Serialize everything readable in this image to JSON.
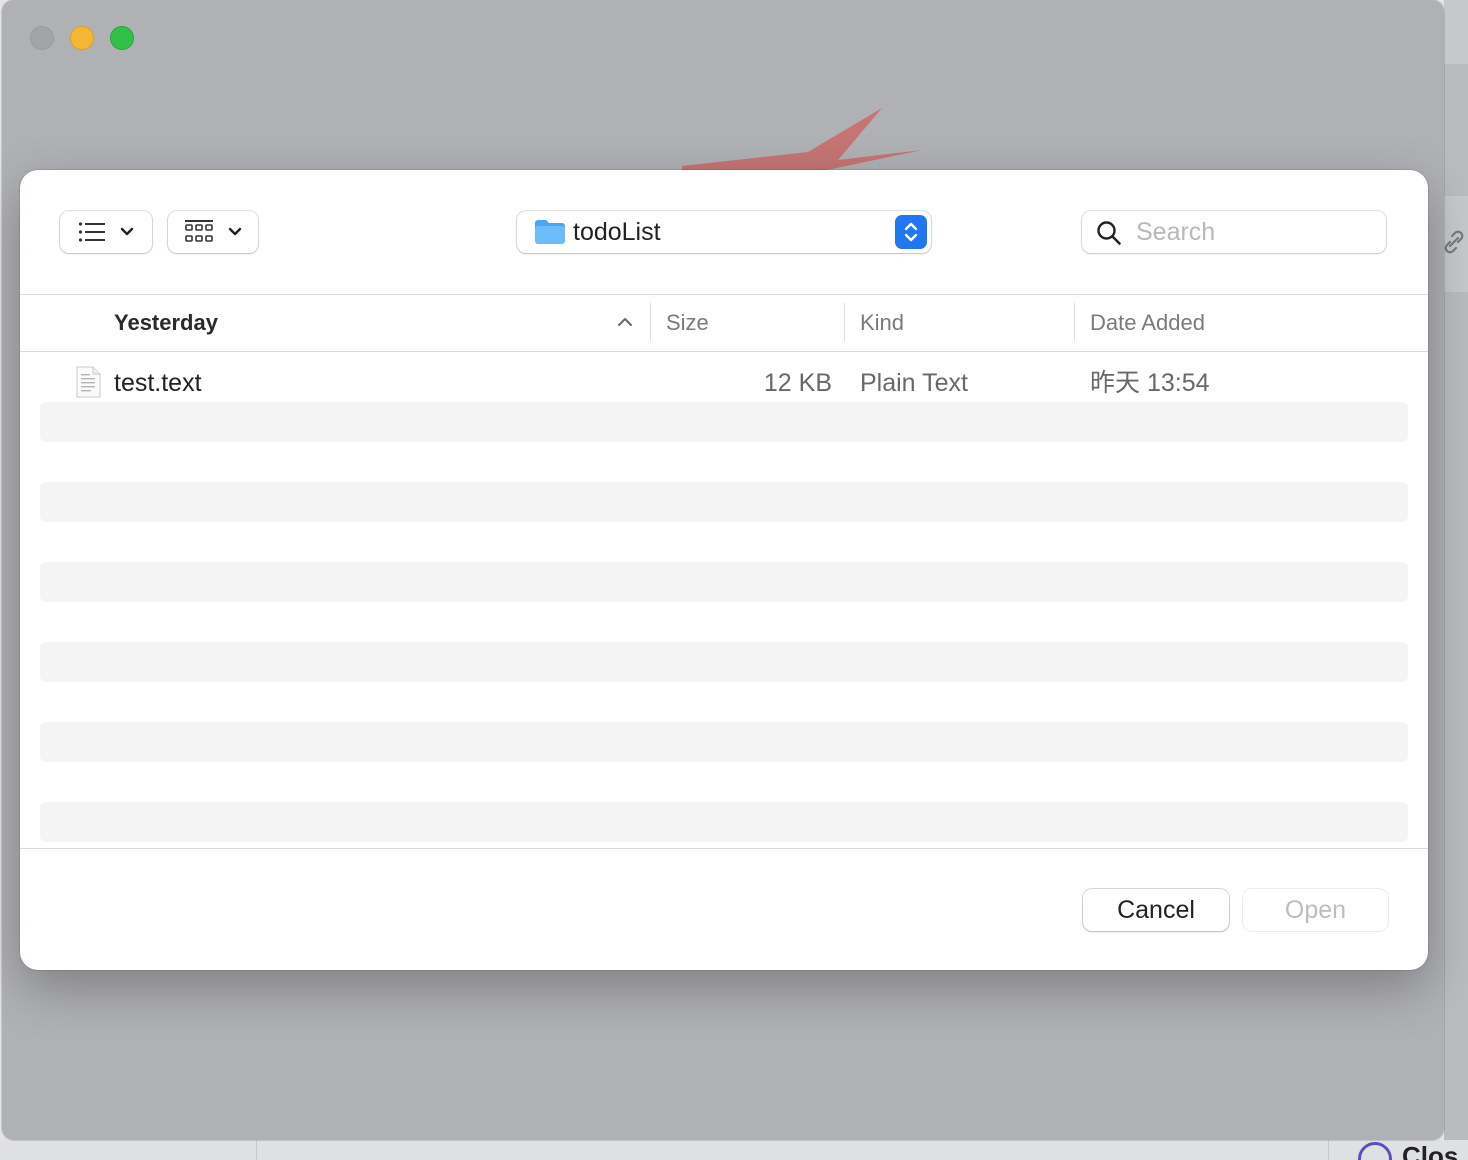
{
  "window": {
    "traffic_lights": [
      "close",
      "minimize",
      "maximize"
    ]
  },
  "background": {
    "close_label": "Clos"
  },
  "dialog": {
    "toolbar": {
      "list_view_icon": "list-view-icon",
      "grid_view_icon": "grid-view-icon",
      "location": "todoList",
      "search_placeholder": "Search"
    },
    "columns": {
      "name": "Yesterday",
      "size": "Size",
      "kind": "Kind",
      "date_added": "Date Added"
    },
    "files": [
      {
        "name": "test.text",
        "size": "12 KB",
        "kind": "Plain Text",
        "date_added": "昨天 13:54"
      }
    ],
    "buttons": {
      "cancel": "Cancel",
      "open": "Open"
    }
  },
  "colors": {
    "accent": "#1f78f1",
    "traffic_minimize": "#f5b731",
    "traffic_maximize": "#32c148",
    "row_stripe": "#f3f4f3"
  }
}
